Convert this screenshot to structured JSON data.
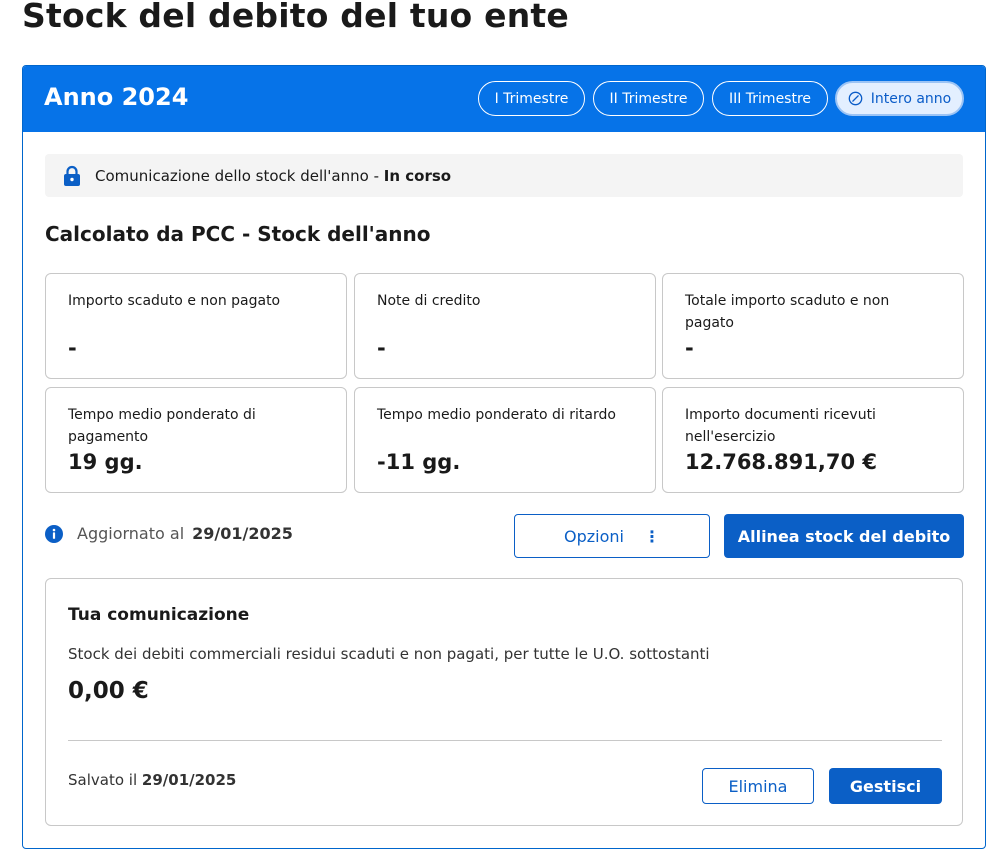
{
  "page": {
    "title": "Stock del debito del tuo ente"
  },
  "header": {
    "year_title": "Anno 2024",
    "periods": [
      {
        "label": "I Trimestre",
        "active": false
      },
      {
        "label": "II Trimestre",
        "active": false
      },
      {
        "label": "III Trimestre",
        "active": false
      },
      {
        "label": "Intero anno",
        "active": true
      }
    ]
  },
  "status": {
    "icon": "lock-icon",
    "prefix": "Comunicazione dello stock dell'anno",
    "separator": " - ",
    "state": "In corso"
  },
  "section": {
    "title": "Calcolato da PCC - Stock dell'anno"
  },
  "metrics": [
    {
      "label": "Importo scaduto e non pagato",
      "value": "-"
    },
    {
      "label": "Note di credito",
      "value": "-"
    },
    {
      "label": "Totale importo scaduto e non pagato",
      "value": "-"
    },
    {
      "label": "Tempo medio ponderato di pagamento",
      "value": "19 gg."
    },
    {
      "label": "Tempo medio ponderato di ritardo",
      "value": "-11 gg."
    },
    {
      "label": "Importo documenti ricevuti nell'esercizio",
      "value": "12.768.891,70 €"
    }
  ],
  "updated": {
    "icon": "info-icon",
    "label": "Aggiornato al",
    "date": "29/01/2025"
  },
  "actions": {
    "options_label": "Opzioni",
    "options_icon": "kebab-icon",
    "align_label": "Allinea stock del debito"
  },
  "communication": {
    "title": "Tua comunicazione",
    "description": "Stock dei debiti commerciali residui scaduti e non pagati, per tutte le U.O. sottostanti",
    "amount": "0,00 €",
    "saved_label": "Salvato il",
    "saved_date": "29/01/2025",
    "delete_label": "Elimina",
    "manage_label": "Gestisci"
  },
  "colors": {
    "primary": "#0673e8",
    "button": "#0b5fc6",
    "border": "#c8c8c8"
  }
}
